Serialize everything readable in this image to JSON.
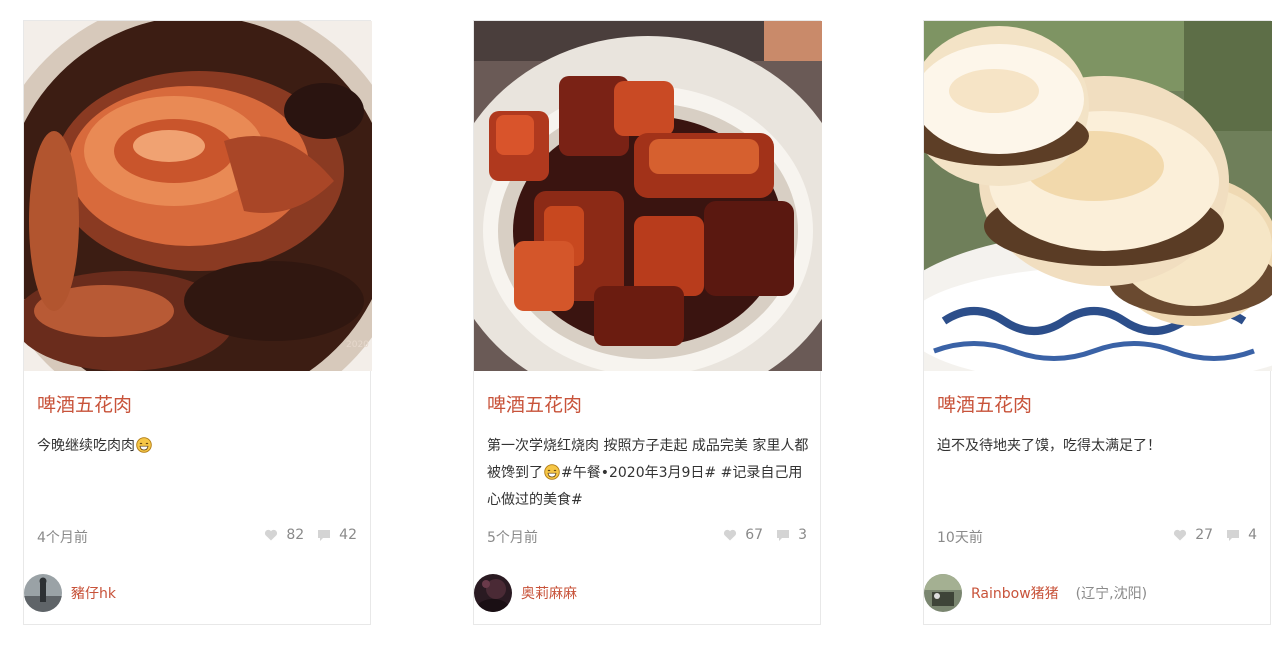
{
  "cards": [
    {
      "title": "啤酒五花肉",
      "desc_before": "今晚继续吃肉肉",
      "desc_after": "",
      "time": "4个月前",
      "likes": "82",
      "comments": "42",
      "author": "豬仔hk",
      "location": ""
    },
    {
      "title": "啤酒五花肉",
      "desc_before": "第一次学烧红烧肉 按照方子走起 成品完美 家里人都被馋到了",
      "desc_after": "#午餐•2020年3月9日# #记录自己用心做过的美食#",
      "time": "5个月前",
      "likes": "67",
      "comments": "3",
      "author": "奥莉麻麻",
      "location": ""
    },
    {
      "title": "啤酒五花肉",
      "desc_before": "迫不及待地夹了馍，吃得太满足了！",
      "desc_after": "",
      "time": "10天前",
      "likes": "27",
      "comments": "4",
      "author": "Rainbow猪猪",
      "location": "(辽宁,沈阳)"
    }
  ],
  "colors": {
    "title": "#c8533a",
    "meta": "#8a8a8a",
    "text": "#333333",
    "border": "#e8e8e8"
  },
  "icons": {
    "like": "heart-icon",
    "comment": "comment-bubble-icon",
    "emoji": "grinning-face-emoji"
  }
}
